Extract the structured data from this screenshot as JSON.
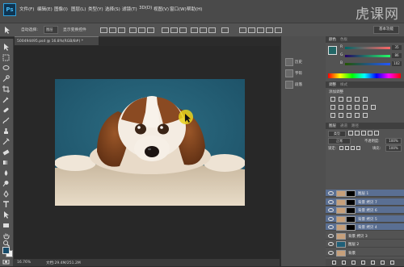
{
  "app": {
    "logo_text": "Ps",
    "watermark": "虎课网"
  },
  "menu": [
    "文件(F)",
    "编辑(E)",
    "图像(I)",
    "图层(L)",
    "类型(Y)",
    "选择(S)",
    "滤镜(T)",
    "3D(D)",
    "视图(V)",
    "窗口(W)",
    "帮助(H)"
  ],
  "options": {
    "auto_select_label": "自动选择:",
    "auto_select_value": "图层",
    "show_transform_label": "显示变换控件",
    "workspace": "基本功能"
  },
  "document": {
    "tab_title": "500494495.psd @ 16.8%(RGB/8#) *",
    "zoom": "16.76%",
    "doc_info": "文档:29.4M/251.2M"
  },
  "dock": {
    "items": [
      "历史",
      "字符",
      "段落"
    ]
  },
  "color_panel": {
    "tabs": [
      "颜色",
      "色板"
    ],
    "r_label": "R",
    "g_label": "G",
    "b_label": "B",
    "r_value": "35",
    "g_value": "86",
    "b_value": "102",
    "fg_color": "#236666"
  },
  "adjustments_panel": {
    "tabs": [
      "调整",
      "样式"
    ],
    "add_label": "添加调整"
  },
  "layers_panel": {
    "tabs": [
      "图层",
      "通道",
      "路径"
    ],
    "kind_label": "类型",
    "blend_mode": "正常",
    "opacity_label": "不透明度:",
    "opacity": "100%",
    "lock_label": "锁定:",
    "fill_label": "填充:",
    "fill": "100%",
    "layers": [
      {
        "name": "图层 1",
        "selected": true,
        "mask": true
      },
      {
        "name": "背景 拷贝 7",
        "selected": true,
        "mask": true
      },
      {
        "name": "背景 拷贝 6",
        "selected": true,
        "mask": true
      },
      {
        "name": "背景 拷贝 5",
        "selected": true,
        "mask": true
      },
      {
        "name": "背景 拷贝 4",
        "selected": true,
        "mask": true
      },
      {
        "name": "背景 拷贝 3",
        "selected": false,
        "mask": false
      },
      {
        "name": "图层 2",
        "selected": false,
        "mask": false
      },
      {
        "name": "背景",
        "selected": false,
        "mask": false
      }
    ]
  }
}
